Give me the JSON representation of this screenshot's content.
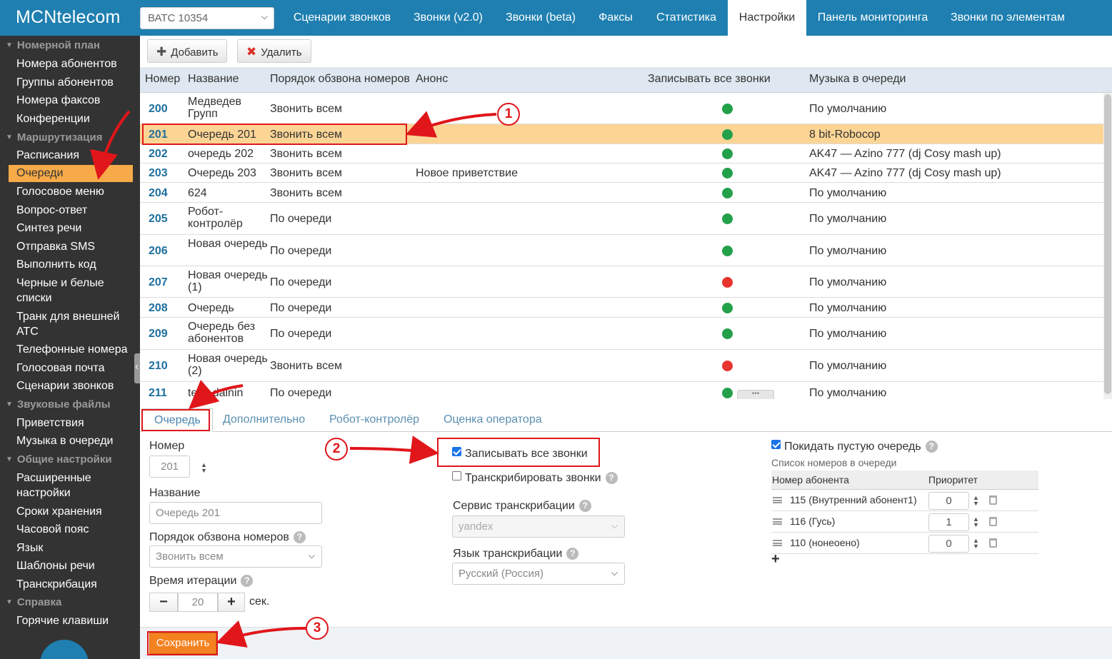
{
  "app": {
    "logo": "MCNtelecom"
  },
  "pbx_select": {
    "value": "ВАТС 10354"
  },
  "nav_tabs": [
    {
      "label": "Сценарии звонков"
    },
    {
      "label": "Звонки (v2.0)"
    },
    {
      "label": "Звонки (beta)"
    },
    {
      "label": "Факсы"
    },
    {
      "label": "Статистика"
    },
    {
      "label": "Настройки",
      "active": true
    },
    {
      "label": "Панель мониторинга"
    },
    {
      "label": "Звонки по элементам"
    }
  ],
  "sidebar": {
    "groups": [
      "Номерной план",
      "Маршрутизация",
      "Звуковые файлы",
      "Общие настройки",
      "Справка"
    ],
    "items": [
      "Номера абонентов",
      "Группы абонентов",
      "Номера факсов",
      "Конференции",
      "Расписания",
      "Очереди",
      "Голосовое меню",
      "Вопрос-ответ",
      "Синтез речи",
      "Отправка SMS",
      "Выполнить код",
      "Черные и белые",
      "списки",
      "Транк для внешней",
      "АТС",
      "Телефонные номера",
      "Голосовая почта",
      "Сценарии звонков",
      "Приветствия",
      "Музыка в очереди",
      "Расширенные",
      "настройки",
      "Сроки хранения",
      "Часовой пояс",
      "Язык",
      "Шаблоны речи",
      "Транскрибация",
      "Горячие клавиши"
    ]
  },
  "toolbar": {
    "add_label": "Добавить",
    "delete_label": "Удалить"
  },
  "grid": {
    "columns": [
      "Номер",
      "Название",
      "Порядок обзвона номеров",
      "Анонс",
      "Записывать все звонки",
      "Музыка в очереди"
    ],
    "rows": [
      {
        "num": "200",
        "name": "Медведев Групп",
        "order": "Звонить всем",
        "announce": "",
        "record": "green",
        "music": "По умолчанию"
      },
      {
        "num": "201",
        "name": "Очередь 201",
        "order": "Звонить всем",
        "announce": "",
        "record": "green",
        "music": "8 bit-Robocop",
        "selected": true
      },
      {
        "num": "202",
        "name": "очередь 202",
        "order": "Звонить всем",
        "announce": "",
        "record": "green",
        "music": "AK47 — Azino 777 (dj Cosy mash up)"
      },
      {
        "num": "203",
        "name": "Очередь 203",
        "order": "Звонить всем",
        "announce": "Новое приветствие",
        "record": "green",
        "music": "AK47 — Azino 777 (dj Cosy mash up)"
      },
      {
        "num": "204",
        "name": "624",
        "order": "Звонить всем",
        "announce": "",
        "record": "green",
        "music": "По умолчанию"
      },
      {
        "num": "205",
        "name": "Робот-контролёр",
        "order": "По очереди",
        "announce": "",
        "record": "green",
        "music": "По умолчанию"
      },
      {
        "num": "206",
        "name": "Новая очередь",
        "order": "По очереди",
        "announce": "",
        "record": "green",
        "music": "По умолчанию"
      },
      {
        "num": "207",
        "name": "Новая очередь (1)",
        "order": "По очереди",
        "announce": "",
        "record": "red",
        "music": "По умолчанию"
      },
      {
        "num": "208",
        "name": "Очередь",
        "order": "По очереди",
        "announce": "",
        "record": "green",
        "music": "По умолчанию"
      },
      {
        "num": "209",
        "name": "Очередь без абонентов",
        "order": "По очереди",
        "announce": "",
        "record": "green",
        "music": "По умолчанию"
      },
      {
        "num": "210",
        "name": "Новая очередь (2)",
        "order": "Звонить всем",
        "announce": "",
        "record": "red",
        "music": "По умолчанию"
      },
      {
        "num": "211",
        "name": "test_dainin",
        "order": "По очереди",
        "announce": "",
        "record": "green",
        "music": "По умолчанию"
      }
    ]
  },
  "tabs": [
    "Очередь",
    "Дополнительно",
    "Робот-контролёр",
    "Оценка оператора"
  ],
  "form": {
    "number_label": "Номер",
    "number_value": "201",
    "name_label": "Название",
    "name_value": "Очередь 201",
    "order_label": "Порядок обзвона номеров",
    "order_value": "Звонить всем",
    "iteration_label": "Время итерации",
    "iteration_value": "20",
    "iteration_unit": "сек.",
    "record_all_label": "Записывать все звонки",
    "record_all_checked": true,
    "transcribe_label": "Транскрибировать звонки",
    "transcribe_checked": false,
    "service_label": "Сервис транскрибации",
    "service_value": "yandex",
    "lang_label": "Язык транскрибации",
    "lang_value": "Русский (Россия)",
    "leave_empty_label": "Покидать пустую очередь",
    "leave_empty_checked": true,
    "queue_list_label": "Список номеров в очереди",
    "queue_cols": [
      "Номер абонента",
      "Приоритет"
    ],
    "queue_rows": [
      {
        "subscriber": "115 (Внутренний абонент1)",
        "priority": "0"
      },
      {
        "subscriber": "116 (Гусь)",
        "priority": "1"
      },
      {
        "subscriber": "110 (нонеоено)",
        "priority": "0"
      }
    ],
    "add_symbol": "+",
    "save_label": "Сохранить"
  },
  "annotations": [
    "1",
    "2",
    "3"
  ],
  "colors": {
    "brand": "#1e7fb0",
    "sidebar": "#333333",
    "selected": "#fcd595",
    "accent": "#f6aa48",
    "save": "#f58220",
    "annotation": "#e0161b"
  }
}
